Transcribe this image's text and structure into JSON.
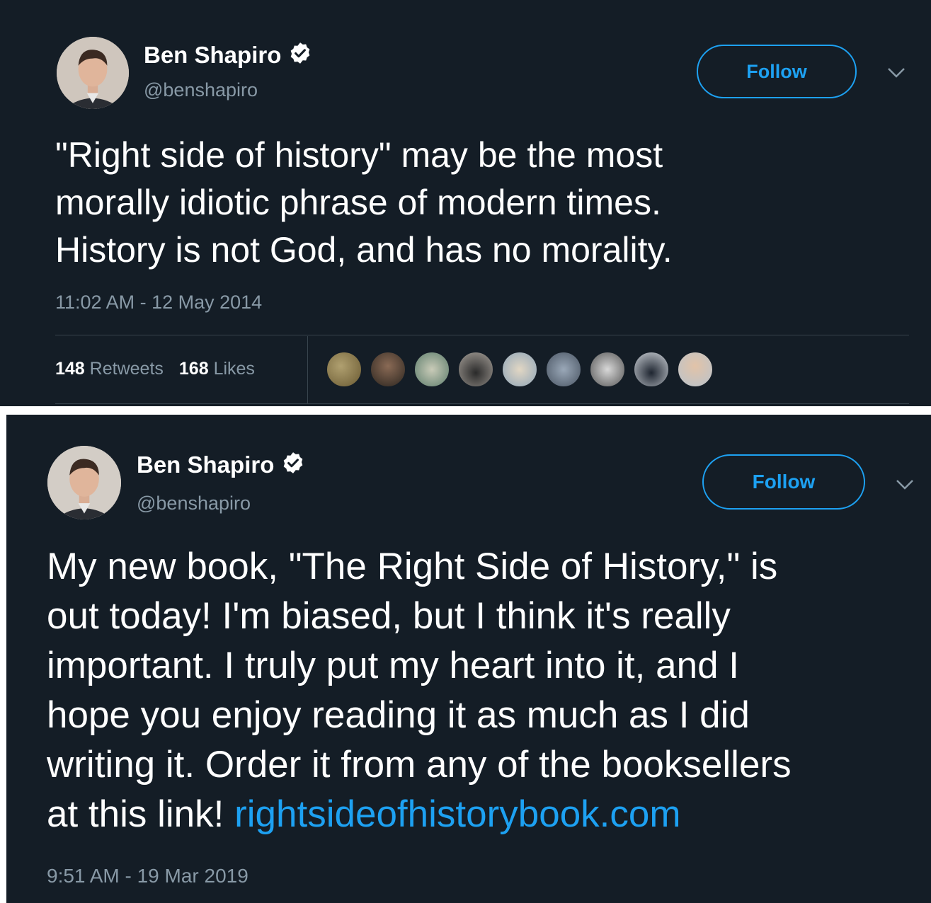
{
  "tweets": [
    {
      "author": {
        "name": "Ben Shapiro",
        "handle": "@benshapiro",
        "verified": true
      },
      "follow_label": "Follow",
      "text": "\"Right side of history\" may be the most\nmorally idiotic phrase of modern times.\nHistory is not God, and has no morality.",
      "timestamp": "11:02 AM - 12 May 2014",
      "stats": {
        "retweets_count": "148",
        "retweets_label": "Retweets",
        "likes_count": "168",
        "likes_label": "Likes"
      }
    },
    {
      "author": {
        "name": "Ben Shapiro",
        "handle": "@benshapiro",
        "verified": true
      },
      "follow_label": "Follow",
      "text": "My new book, \"The Right Side of History,\" is\nout today! I'm biased, but I think it's really\nimportant. I truly put my heart into it, and I\nhope you enjoy reading it as much as I did\nwriting it. Order it from any of the booksellers\nat this link! ",
      "link": "rightsideofhistorybook.com",
      "timestamp": "9:51 AM - 19 Mar 2019"
    }
  ],
  "colors": {
    "background": "#141d26",
    "accent": "#1da1f2",
    "secondary_text": "#8899a6",
    "divider": "#38444d"
  },
  "icons": [
    "verified-badge-icon",
    "chevron-down-icon"
  ]
}
